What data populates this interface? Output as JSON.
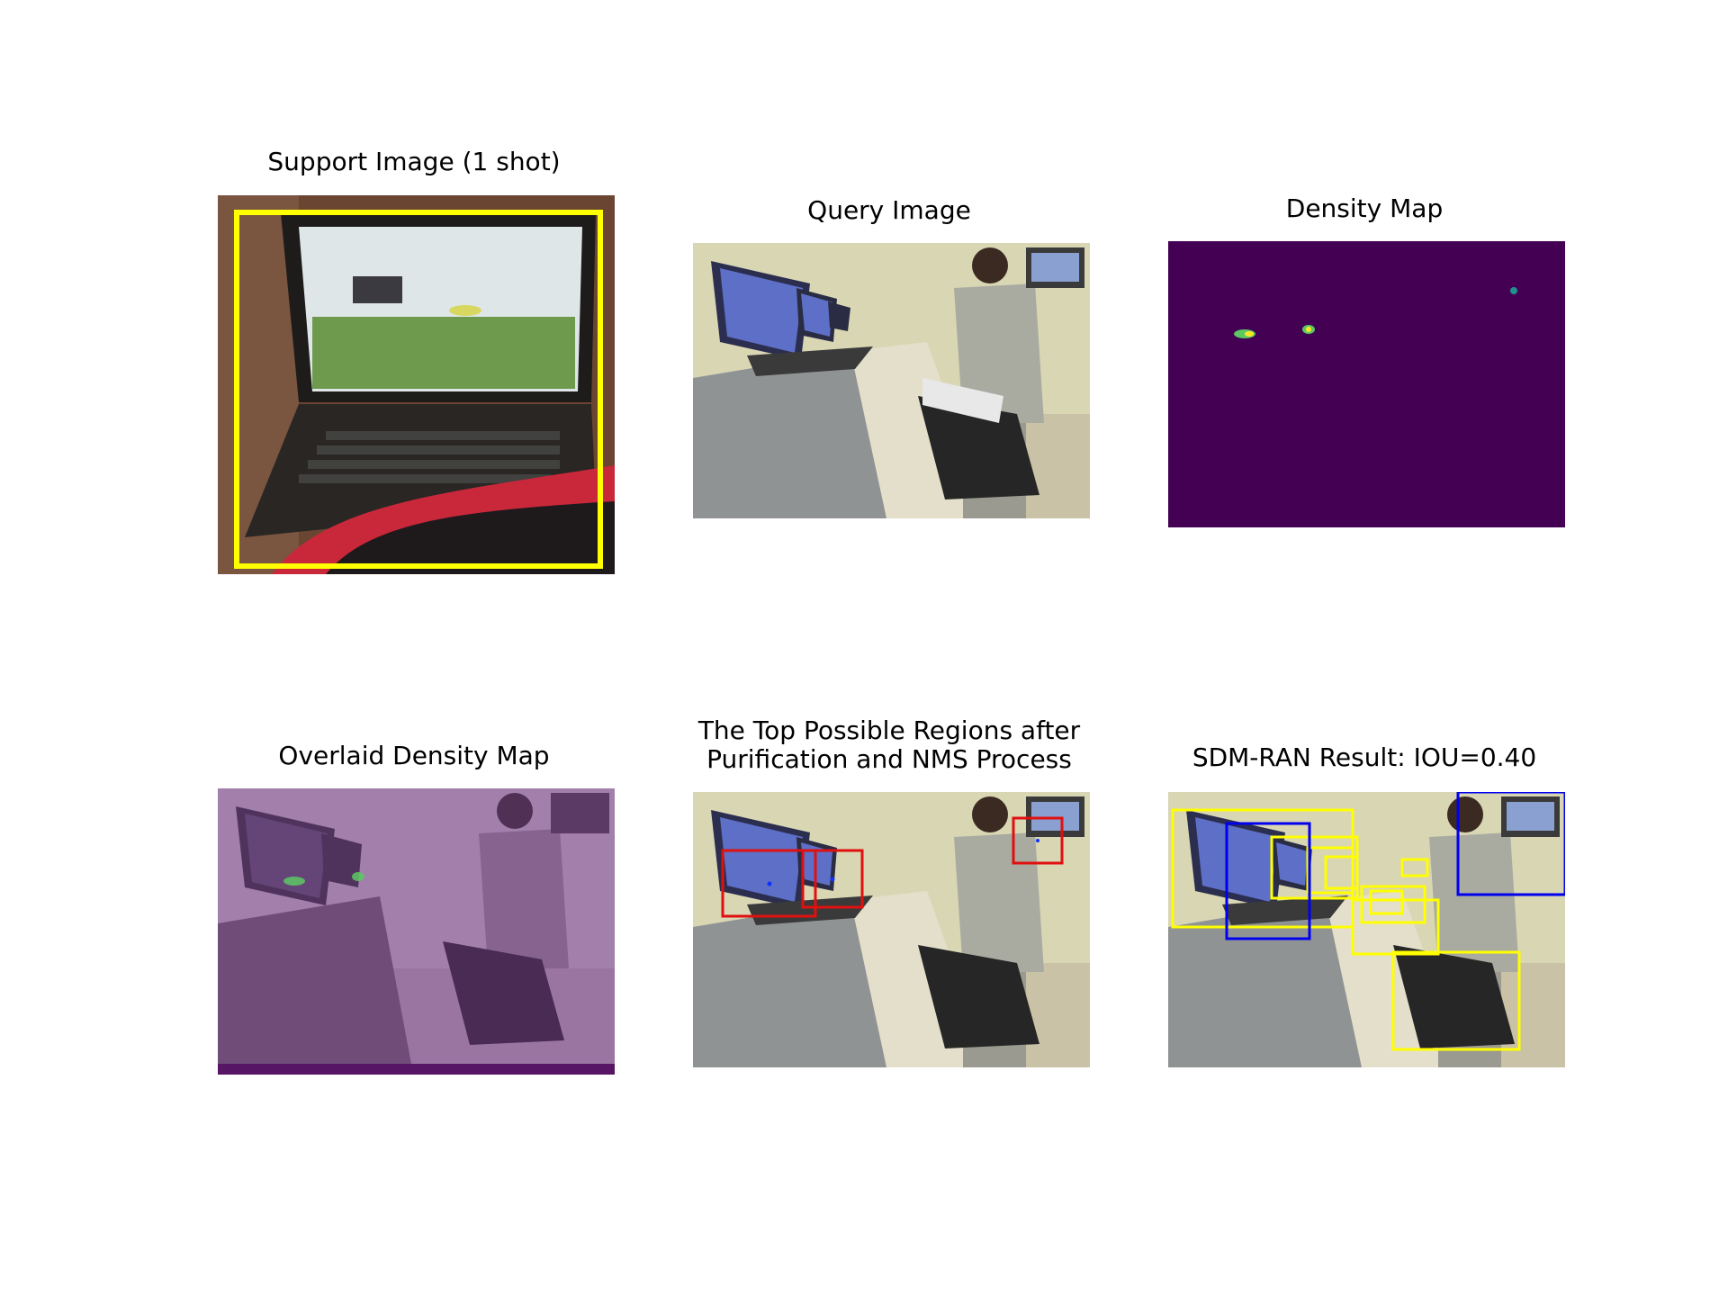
{
  "figure": {
    "panels": [
      {
        "id": "support",
        "title": "Support Image (1 shot)"
      },
      {
        "id": "query",
        "title": "Query Image"
      },
      {
        "id": "density",
        "title": "Density Map"
      },
      {
        "id": "overlaid",
        "title": "Overlaid Density Map"
      },
      {
        "id": "regions",
        "title_line1": "The Top Possible Regions after",
        "title_line2": "Purification and NMS Process"
      },
      {
        "id": "result",
        "title": "SDM-RAN Result: IOU=0.40"
      }
    ],
    "colors": {
      "support_box": "#ffff00",
      "region_box": "#e01010",
      "region_center": "#1030ff",
      "pred_box": "#ffff00",
      "gt_box": "#0000ee",
      "density_bg": "#440154",
      "density_peak": "#5cc863",
      "density_hot": "#fde725",
      "overlay_tint": "#8b4f9a"
    }
  }
}
